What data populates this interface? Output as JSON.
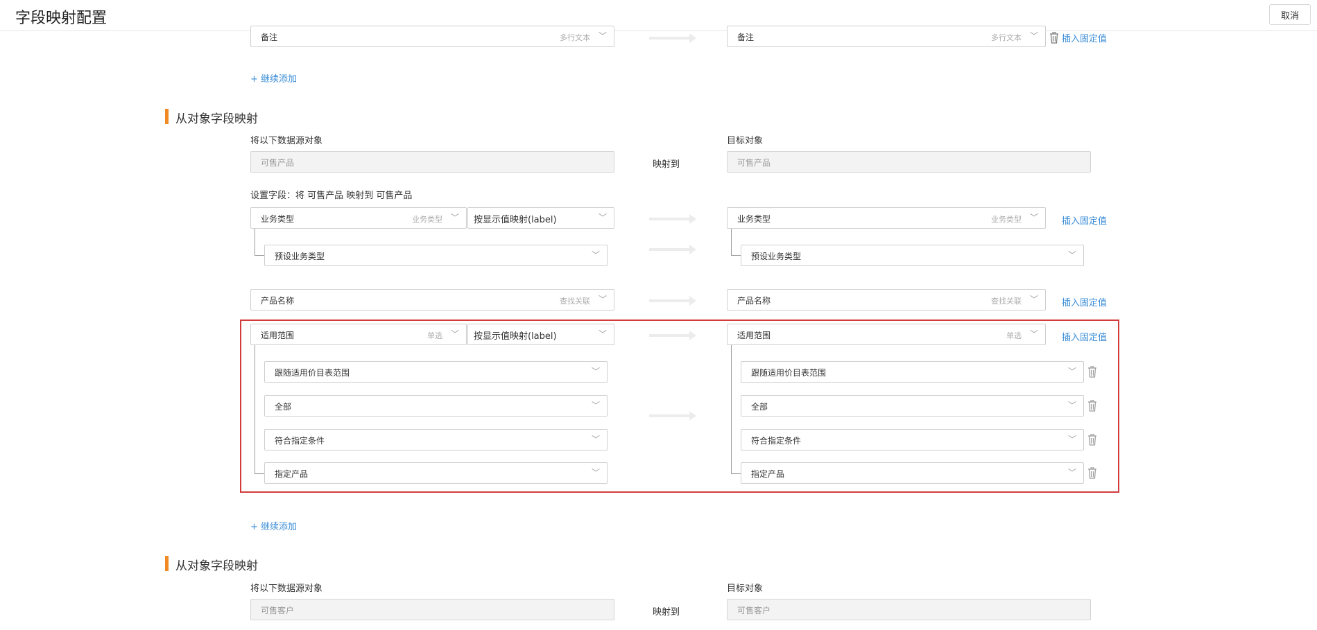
{
  "header": {
    "title": "字段映射配置",
    "cancel_label": "取消"
  },
  "top_row": {
    "source": {
      "label": "备注",
      "type": "多行文本"
    },
    "target": {
      "label": "备注",
      "type": "多行文本"
    },
    "insert_label": "插入固定值"
  },
  "add_more_1": "+ 继续添加",
  "section1": {
    "title": "从对象字段映射",
    "source_caption": "将以下数据源对象",
    "target_caption": "目标对象",
    "source_object": "可售产品",
    "map_to": "映射到",
    "target_object": "可售产品",
    "set_fields": "设置字段：将 可售产品 映射到 可售产品",
    "rows": {
      "biz_type": {
        "source_label": "业务类型",
        "source_type": "业务类型",
        "mode": "按显示值映射(label)",
        "target_label": "业务类型",
        "target_type": "业务类型",
        "insert": "插入固定值",
        "sub_source": "预设业务类型",
        "sub_target": "预设业务类型"
      },
      "product_name": {
        "source_label": "产品名称",
        "source_type": "查找关联",
        "target_label": "产品名称",
        "target_type": "查找关联",
        "insert": "插入固定值"
      },
      "scope": {
        "source_label": "适用范围",
        "source_type": "单选",
        "mode": "按显示值映射(label)",
        "target_label": "适用范围",
        "target_type": "单选",
        "insert": "插入固定值",
        "options": [
          "跟随适用价目表范围",
          "全部",
          "符合指定条件",
          "指定产品"
        ]
      }
    }
  },
  "add_more_2": "+ 继续添加",
  "section2": {
    "title": "从对象字段映射",
    "source_caption": "将以下数据源对象",
    "target_caption": "目标对象",
    "source_object": "可售客户",
    "map_to": "映射到",
    "target_object": "可售客户"
  },
  "colors": {
    "accent": "#f08a24",
    "link": "#3b8ed8",
    "highlight": "#d23b3b"
  }
}
